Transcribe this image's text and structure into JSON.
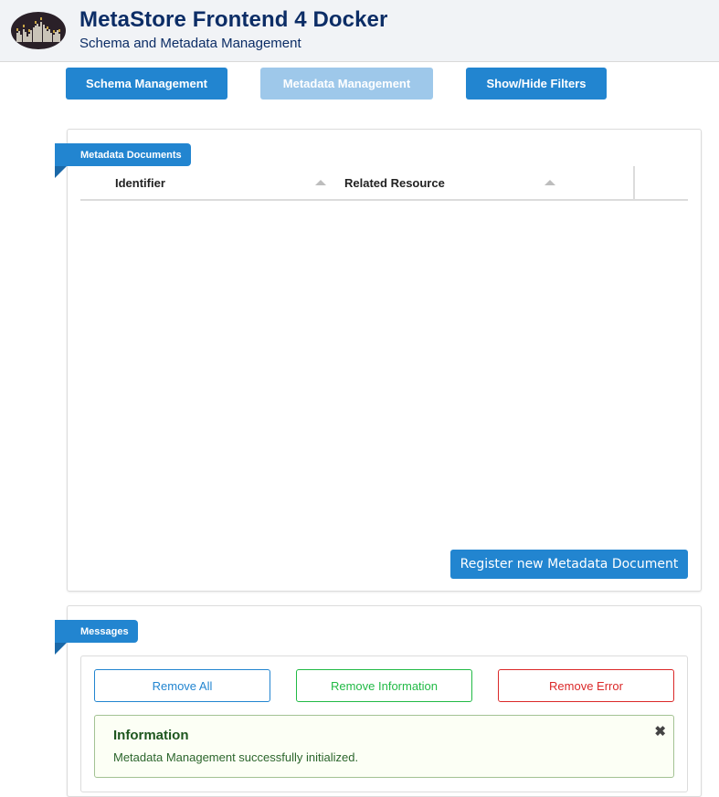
{
  "header": {
    "title": "MetaStore Frontend 4 Docker",
    "subtitle": "Schema and Metadata Management",
    "logo_icon": "logo-icon"
  },
  "nav": {
    "buttons": [
      {
        "label": "Schema Management",
        "state": "active"
      },
      {
        "label": "Metadata Management",
        "state": "disabled"
      },
      {
        "label": "Show/Hide Filters",
        "state": "active"
      }
    ]
  },
  "documents_panel": {
    "ribbon": "Metadata Documents",
    "columns": [
      {
        "label": "Identifier",
        "sort": "ascending"
      },
      {
        "label": "Related Resource",
        "sort": "ascending"
      }
    ],
    "rows": [],
    "register_button": "Register new Metadata Document"
  },
  "messages_panel": {
    "ribbon": "Messages",
    "buttons": {
      "remove_all": "Remove All",
      "remove_information": "Remove Information",
      "remove_error": "Remove Error"
    },
    "messages": [
      {
        "type": "information",
        "title": "Information",
        "text": "Metadata Management successfully initialized.",
        "close_icon": "close-icon"
      }
    ]
  },
  "colors": {
    "primary": "#2285d0",
    "primary_disabled": "#9ec8ea",
    "title": "#0c2d66",
    "success_border": "#21ba45",
    "error_border": "#db2828",
    "info_bg": "#fcfff5"
  }
}
